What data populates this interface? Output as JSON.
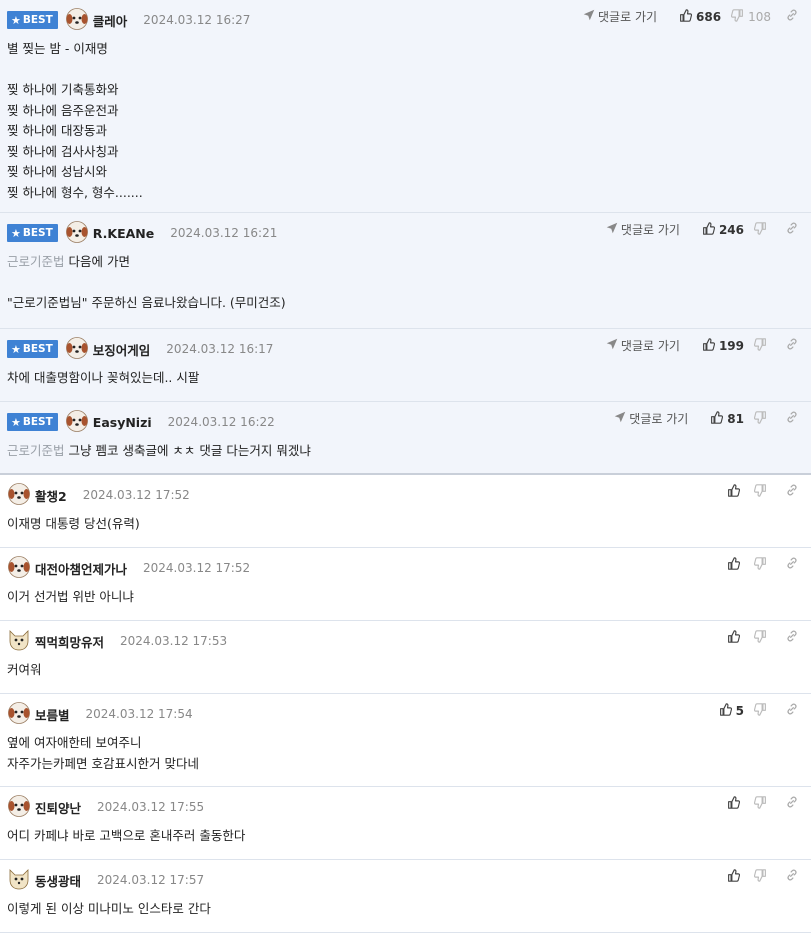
{
  "reply_go_label": "댓글로 가기",
  "best_label": "BEST",
  "comments": [
    {
      "nick": "클레아",
      "date": "2024.03.12 16:27",
      "up": "686",
      "down": "108",
      "mention": "",
      "text": "별 찢는 밤 - 이재명\n\n찢 하나에 기축통화와\n찢 하나에 음주운전과\n찢 하나에 대장동과\n찢 하나에 검사사칭과\n찢 하나에 성남시와\n찢 하나에 형수, 형수......."
    },
    {
      "nick": "R.KEANe",
      "date": "2024.03.12 16:21",
      "up": "246",
      "down": "",
      "mention": "근로기준법",
      "text": "다음에 가면\n\n\"근로기준법님\" 주문하신 음료나왔습니다. (무미건조)"
    },
    {
      "nick": "보징어게임",
      "date": "2024.03.12 16:17",
      "up": "199",
      "down": "",
      "mention": "",
      "text": "차에 대출명함이나 꽂혀있는데.. 시팔"
    },
    {
      "nick": "EasyNizi",
      "date": "2024.03.12 16:22",
      "up": "81",
      "down": "",
      "mention": "근로기준법",
      "text": "그냥 펨코 생축글에 ㅊㅊ 댓글 다는거지 뭐겠냐"
    },
    {
      "nick": "활챙2",
      "date": "2024.03.12 17:52",
      "up": "",
      "down": "",
      "mention": "",
      "text": "이재명 대통령 당선(유력)"
    },
    {
      "nick": "대전아챔언제가나",
      "date": "2024.03.12 17:52",
      "up": "",
      "down": "",
      "mention": "",
      "text": "이거 선거법 위반 아니냐"
    },
    {
      "nick": "찍먹희망유저",
      "date": "2024.03.12 17:53",
      "up": "",
      "down": "",
      "mention": "",
      "text": "커여워"
    },
    {
      "nick": "보름별",
      "date": "2024.03.12 17:54",
      "up": "5",
      "down": "",
      "mention": "",
      "text": "옆에 여자애한테 보여주니\n자주가는카페면 호감표시한거 맞다네"
    },
    {
      "nick": "진퇴양난",
      "date": "2024.03.12 17:55",
      "up": "",
      "down": "",
      "mention": "",
      "text": "어디 카페냐 바로 고백으로 혼내주러 출동한다"
    },
    {
      "nick": "동생광태",
      "date": "2024.03.12 17:57",
      "up": "",
      "down": "",
      "mention": "",
      "text": "이렇게 된 이상 미나미노 인스타로 간다"
    }
  ]
}
